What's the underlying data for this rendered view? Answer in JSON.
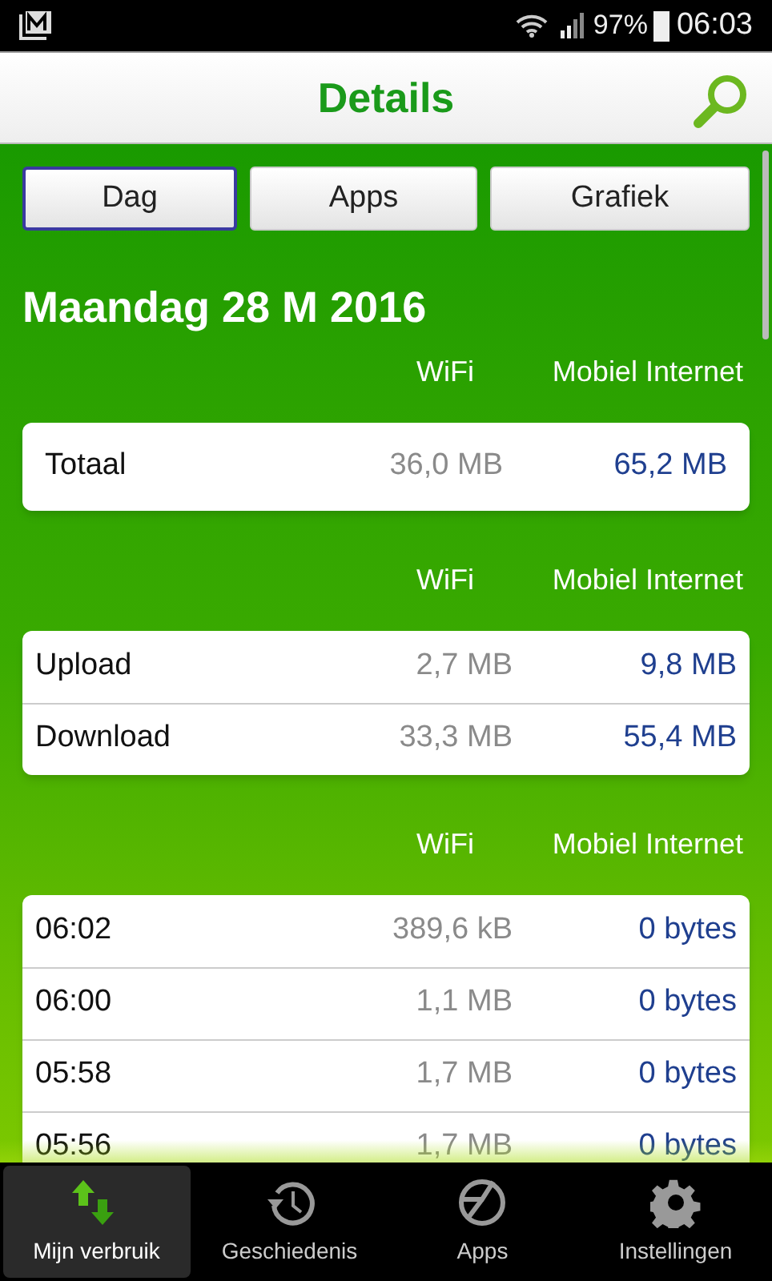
{
  "status_bar": {
    "battery": "97%",
    "time": "06:03"
  },
  "header": {
    "title": "Details"
  },
  "tabs": [
    {
      "label": "Dag",
      "selected": true
    },
    {
      "label": "Apps",
      "selected": false
    },
    {
      "label": "Grafiek",
      "selected": false
    }
  ],
  "date": "Maandag 28 M 2016",
  "sections": [
    {
      "columns": [
        "WiFi",
        "Mobiel Internet"
      ],
      "rows": [
        {
          "label": "Totaal",
          "wifi": "36,0 MB",
          "mobile": "65,2 MB"
        }
      ]
    },
    {
      "columns": [
        "WiFi",
        "Mobiel Internet"
      ],
      "rows": [
        {
          "label": "Upload",
          "wifi": "2,7 MB",
          "mobile": "9,8 MB"
        },
        {
          "label": "Download",
          "wifi": "33,3 MB",
          "mobile": "55,4 MB"
        }
      ]
    },
    {
      "columns": [
        "WiFi",
        "Mobiel Internet"
      ],
      "rows": [
        {
          "label": "06:02",
          "wifi": "389,6 kB",
          "mobile": "0 bytes"
        },
        {
          "label": "06:00",
          "wifi": "1,1 MB",
          "mobile": "0 bytes"
        },
        {
          "label": "05:58",
          "wifi": "1,7 MB",
          "mobile": "0 bytes"
        },
        {
          "label": "05:56",
          "wifi": "1,7 MB",
          "mobile": "0 bytes"
        }
      ]
    }
  ],
  "bottom_nav": [
    {
      "label": "Mijn verbruik",
      "selected": true
    },
    {
      "label": "Geschiedenis",
      "selected": false
    },
    {
      "label": "Apps",
      "selected": false
    },
    {
      "label": "Instellingen",
      "selected": false
    }
  ]
}
